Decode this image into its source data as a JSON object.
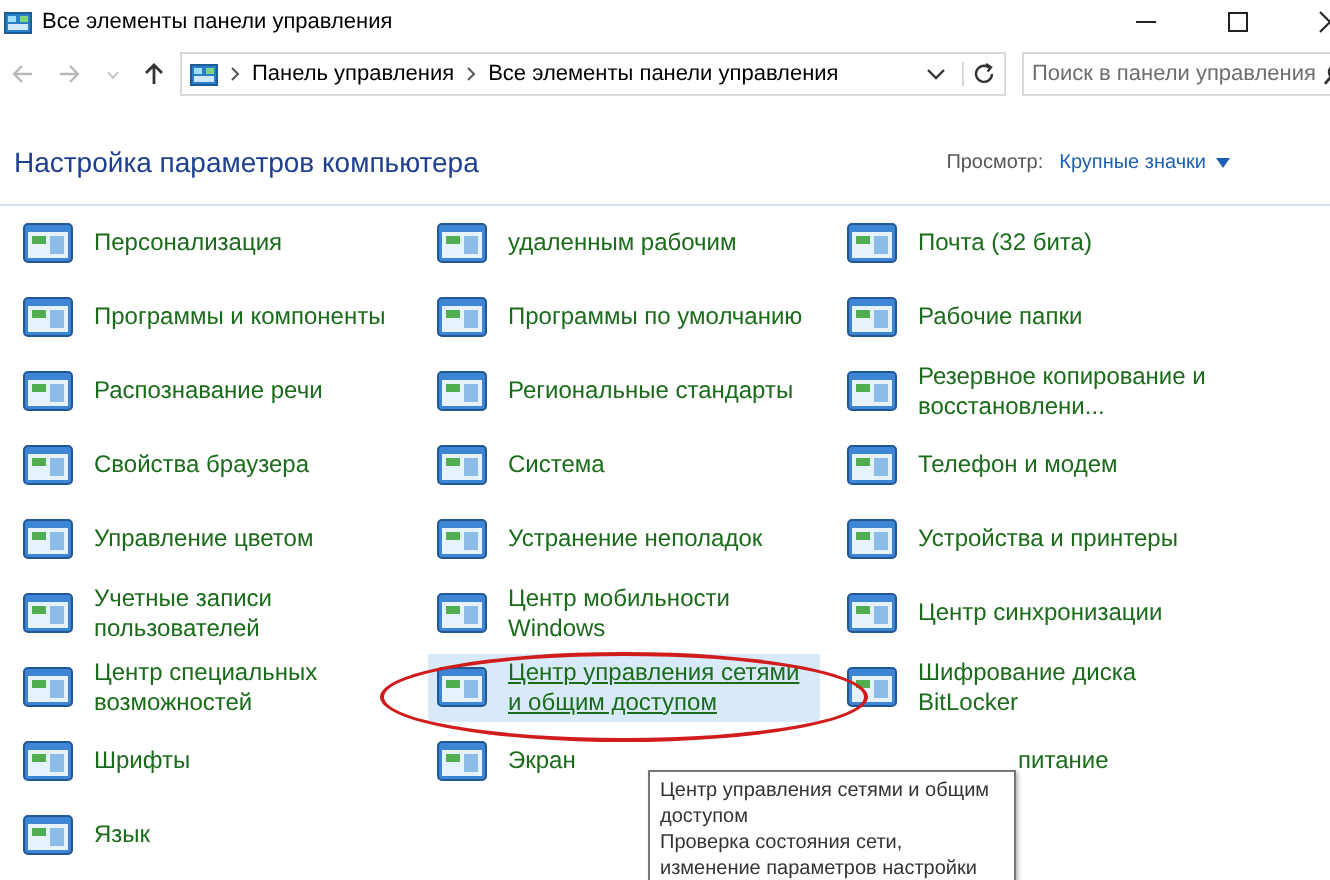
{
  "window": {
    "title": "Все элементы панели управления"
  },
  "address_bar": {
    "path": [
      {
        "label": "Панель управления"
      },
      {
        "label": "Все элементы панели управления"
      }
    ]
  },
  "search": {
    "placeholder": "Поиск в панели управления"
  },
  "header": {
    "title": "Настройка параметров компьютера",
    "view_label": "Просмотр:",
    "view_value": "Крупные значки"
  },
  "items": [
    {
      "label": "Персонализация",
      "selected": false,
      "circled": false
    },
    {
      "label": "удаленным рабочим",
      "selected": false,
      "circled": false
    },
    {
      "label": "Почта (32 бита)",
      "selected": false,
      "circled": false
    },
    {
      "label": "Программы и компоненты",
      "selected": false,
      "circled": false
    },
    {
      "label": "Программы по умолчанию",
      "selected": false,
      "circled": false
    },
    {
      "label": "Рабочие папки",
      "selected": false,
      "circled": false
    },
    {
      "label": "Распознавание речи",
      "selected": false,
      "circled": false
    },
    {
      "label": "Региональные стандарты",
      "selected": false,
      "circled": false
    },
    {
      "label": "Резервное копирование и восстановлени...",
      "selected": false,
      "circled": false
    },
    {
      "label": "Свойства браузера",
      "selected": false,
      "circled": false
    },
    {
      "label": "Система",
      "selected": false,
      "circled": false
    },
    {
      "label": "Телефон и модем",
      "selected": false,
      "circled": false
    },
    {
      "label": "Управление цветом",
      "selected": false,
      "circled": false
    },
    {
      "label": "Устранение неполадок",
      "selected": false,
      "circled": false
    },
    {
      "label": "Устройства и принтеры",
      "selected": false,
      "circled": false
    },
    {
      "label": "Учетные записи пользователей",
      "selected": false,
      "circled": false
    },
    {
      "label": "Центр мобильности Windows",
      "selected": false,
      "circled": false
    },
    {
      "label": "Центр синхронизации",
      "selected": false,
      "circled": false
    },
    {
      "label": "Центр специальных возможностей",
      "selected": false,
      "circled": false
    },
    {
      "label": "Центр управления сетями и общим доступом",
      "selected": true,
      "circled": true
    },
    {
      "label": "Шифрование диска BitLocker",
      "selected": false,
      "circled": false
    },
    {
      "label": "Шрифты",
      "selected": false,
      "circled": false
    },
    {
      "label": "Экран",
      "selected": false,
      "circled": false
    },
    {
      "label": "питание",
      "selected": false,
      "circled": false,
      "covered": true
    },
    {
      "label": "Язык",
      "selected": false,
      "circled": false
    }
  ],
  "tooltip": {
    "title": "Центр управления сетями и общим доступом",
    "description": "Проверка состояния сети, изменение параметров настройки"
  }
}
